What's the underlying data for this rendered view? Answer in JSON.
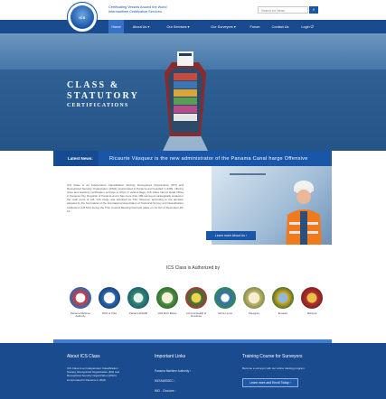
{
  "header": {
    "logo_text": "ICS",
    "tagline_line1": "Certificating Vessels Around the World",
    "tagline_line2": "Intermaritime Certification Services",
    "search_placeholder": "Search for News",
    "search_button": "⌕"
  },
  "nav": {
    "items": [
      {
        "label": "Home",
        "active": true
      },
      {
        "label": "About Us ▾",
        "active": false
      },
      {
        "label": "Our Services ▾",
        "active": false
      },
      {
        "label": "Our Surveyors ▾",
        "active": false
      },
      {
        "label": "Forum",
        "active": false
      },
      {
        "label": "Contact Us",
        "active": false
      },
      {
        "label": "Login ⏻",
        "active": false
      }
    ]
  },
  "hero": {
    "line1": "CLASS &",
    "line2": "STATUTORY",
    "line3": "CERTIFICATIONS"
  },
  "news": {
    "label": "Latest News:",
    "ticker": "Ricaurte Vásquez is the new administrator of the Panama Canal      harge Offensive"
  },
  "intro": {
    "paragraph": "ICS Class is an Independent Classification Society, Recognized Organization (RO) and Recognized Security Organization (RSO) incorporated in Panama and founded in 2009, offering class and statutory certification services to ships of various flags. ICS Class has its Head Office in Panama City, Republic of Panama and it has more than 180 surveyors strategically located in the main ports of call. ICS Class was admitted as TSC Observer according to the decision adopted by the Secretariat of the International Association of Technical Survey and Classification Institutions (IATSCI) during the TSC Council Meeting that took place on 14 Oct of December 18-13.",
    "learn_more": "Learn more About Us ›"
  },
  "authorized": {
    "title": "ICS Class is Authorized by",
    "seals": [
      {
        "name": "Panama Maritime Authority",
        "color": "#d63a3a"
      },
      {
        "name": "RSO of Chia",
        "color": "#2b67b3"
      },
      {
        "name": "Panama DGMM",
        "color": "#2d8b6e"
      },
      {
        "name": "VAN MAX Belize",
        "color": "#4f8f46"
      },
      {
        "name": "Commonwealth of Dominica",
        "color": "#2f7d3a"
      },
      {
        "name": "Sierra Leone",
        "color": "#3a6fb6"
      },
      {
        "name": "Paraguay",
        "color": "#c9b06a"
      },
      {
        "name": "Ecuador",
        "color": "#d9a81e"
      },
      {
        "name": "Moldova",
        "color": "#b5302d"
      }
    ]
  },
  "footer": {
    "about_title": "About ICS Class",
    "about_text": "ICS Class is an Independent Classification Society, Recognized Organization (RO) and Recognized Security Organization (RSO) incorporated in Panama in 2009.",
    "links_title": "Important Links",
    "links": [
      "Panama Maritime Authority ›",
      "IMO/MARSEC ›",
      "IMO - Circulars ›"
    ],
    "training_title": "Training Course for Surveyors",
    "training_text": "Become a surveyor with our online training program.",
    "training_button": "Learn more and Enroll Today ›"
  },
  "colors": {
    "brand_blue": "#1a56a8",
    "nav_blue": "#1b4b8f",
    "footer_blue": "#1b4b8f"
  }
}
